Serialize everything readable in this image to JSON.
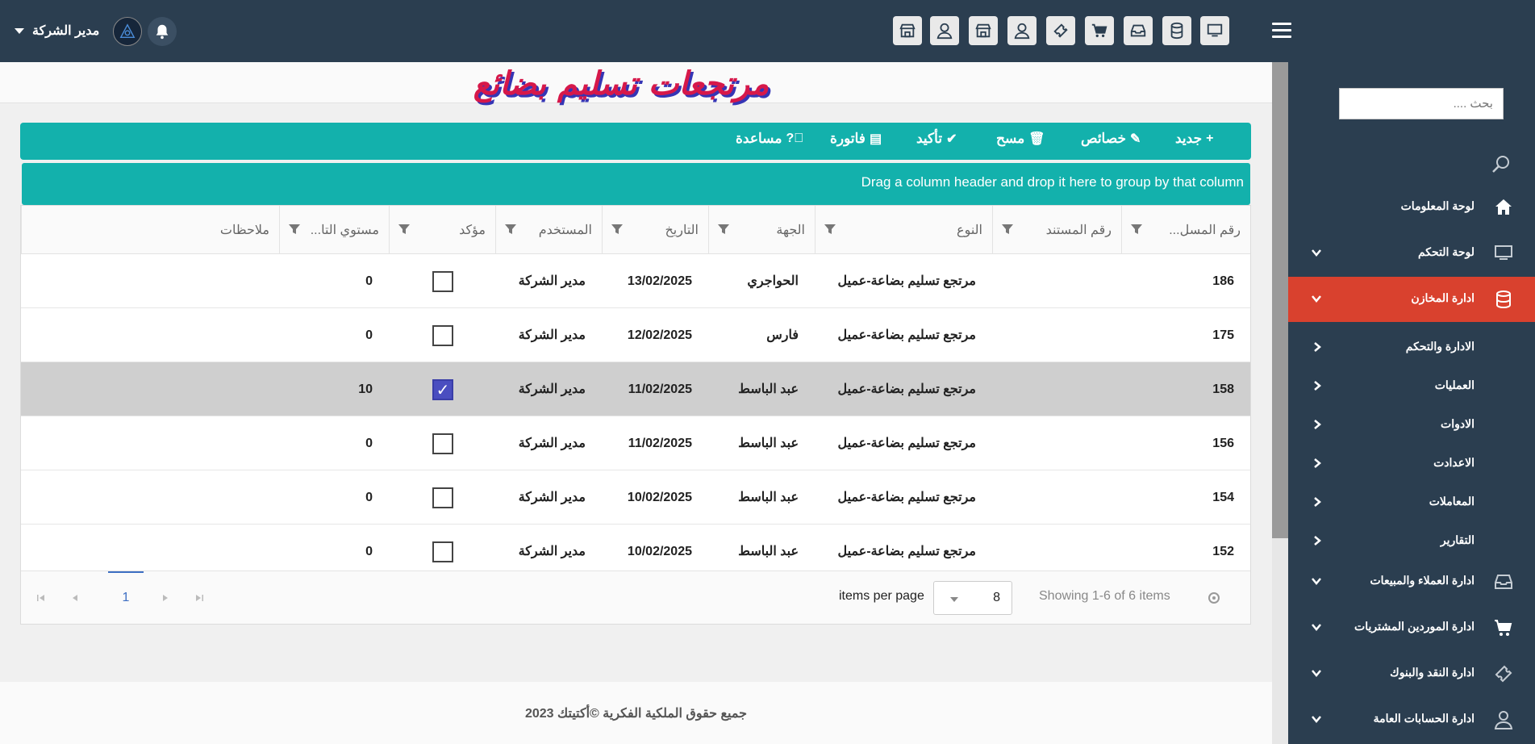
{
  "header": {
    "user_name": "مدير الشركة",
    "toolbar_icons": [
      "monitor-icon",
      "database-icon",
      "inbox-icon",
      "cart-icon",
      "ticket-icon",
      "user-icon",
      "store-icon",
      "user-icon-2",
      "store-icon-2"
    ]
  },
  "page": {
    "title": "مرتجعات تسليم بضائع"
  },
  "toolbar": {
    "new": "جديد",
    "properties": "خصائص",
    "delete": "مسح",
    "confirm": "تأكيد",
    "invoice": "فاتورة",
    "help": "مساعدة"
  },
  "grid": {
    "group_hint": "Drag a column header and drop it here to group by that column",
    "columns": [
      "رقم المسل...",
      "رقم المستند",
      "النوع",
      "الجهة",
      "التاريخ",
      "المستخدم",
      "مؤكد",
      "مستوي التا...",
      "ملاحظات"
    ],
    "rows": [
      {
        "serial": "186",
        "doc": "",
        "type": "مرتجع تسليم بضاعة-عميل",
        "party": "الحواجري",
        "date": "13/02/2025",
        "user": "مدير الشركة",
        "confirmed": false,
        "level": "0",
        "notes": ""
      },
      {
        "serial": "175",
        "doc": "",
        "type": "مرتجع تسليم بضاعة-عميل",
        "party": "فارس",
        "date": "12/02/2025",
        "user": "مدير الشركة",
        "confirmed": false,
        "level": "0",
        "notes": ""
      },
      {
        "serial": "158",
        "doc": "",
        "type": "مرتجع تسليم بضاعة-عميل",
        "party": "عبد الباسط",
        "date": "11/02/2025",
        "user": "مدير الشركة",
        "confirmed": true,
        "level": "10",
        "notes": ""
      },
      {
        "serial": "156",
        "doc": "",
        "type": "مرتجع تسليم بضاعة-عميل",
        "party": "عبد الباسط",
        "date": "11/02/2025",
        "user": "مدير الشركة",
        "confirmed": false,
        "level": "0",
        "notes": ""
      },
      {
        "serial": "154",
        "doc": "",
        "type": "مرتجع تسليم بضاعة-عميل",
        "party": "عبد الباسط",
        "date": "10/02/2025",
        "user": "مدير الشركة",
        "confirmed": false,
        "level": "0",
        "notes": ""
      },
      {
        "serial": "152",
        "doc": "",
        "type": "مرتجع تسليم بضاعة-عميل",
        "party": "عبد الباسط",
        "date": "10/02/2025",
        "user": "مدير الشركة",
        "confirmed": false,
        "level": "0",
        "notes": ""
      }
    ],
    "selected_row": 2
  },
  "pager": {
    "current_page": "1",
    "page_size": "8",
    "items_per_page": "items per page",
    "showing": "Showing 1-6 of 6 items"
  },
  "footer": {
    "text": "جميع حقوق الملكية الفكرية ©أكتيتك 2023"
  },
  "sidebar": {
    "search_placeholder": "بحث ....",
    "items": [
      {
        "label": "لوحة المعلومات",
        "icon": "home-icon",
        "expandable": false,
        "active": false
      },
      {
        "label": "لوحة التحكم",
        "icon": "monitor-icon",
        "expandable": true,
        "active": false
      },
      {
        "label": "ادارة المخازن",
        "icon": "database-icon",
        "expandable": true,
        "active": true
      },
      {
        "label": "ادارة العملاء والمبيعات",
        "icon": "inbox-icon",
        "expandable": true,
        "active": false
      },
      {
        "label": "ادارة الموردين المشتريات",
        "icon": "cart-icon",
        "expandable": true,
        "active": false
      },
      {
        "label": "ادارة النقد والبنوك",
        "icon": "ticket-icon",
        "expandable": true,
        "active": false
      },
      {
        "label": "ادارة الحسابات العامة",
        "icon": "user-icon",
        "expandable": true,
        "active": false
      }
    ],
    "subitems": [
      "الادارة والتحكم",
      "العمليات",
      "الادوات",
      "الاعدادت",
      "المعاملات",
      "التقارير"
    ]
  },
  "colors": {
    "topbar": "#2b3e50",
    "accent_teal": "#13b1ac",
    "active_red": "#d9412e",
    "checkbox_checked": "#4a4ec0",
    "pager_active": "#3e6fc3"
  }
}
